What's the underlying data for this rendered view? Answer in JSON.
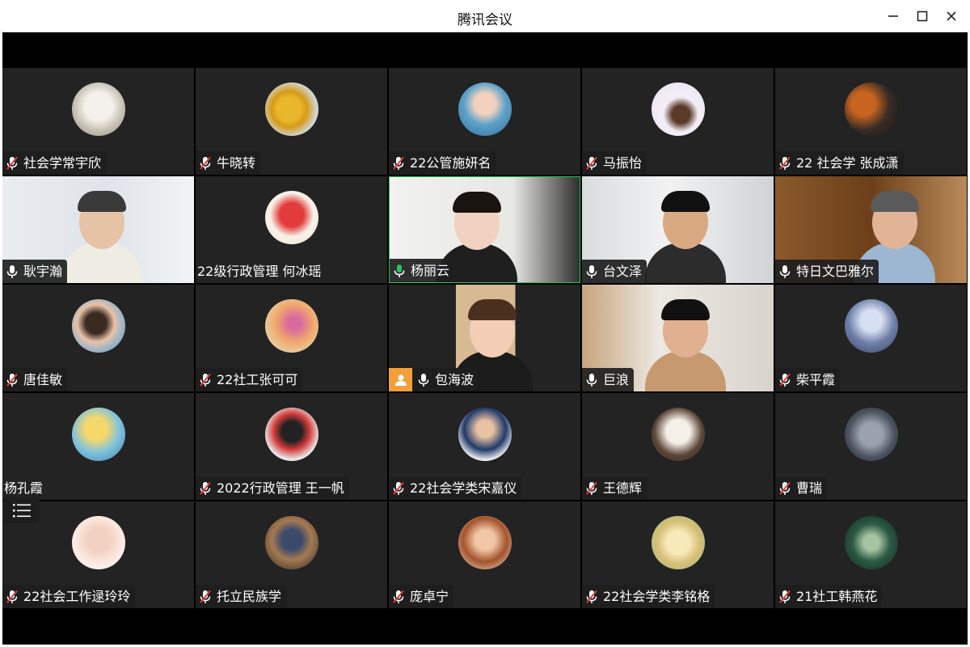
{
  "window": {
    "title": "腾讯会议",
    "controls": [
      "minimize-icon",
      "maximize-icon",
      "close-icon"
    ]
  },
  "colors": {
    "speaking": "#26c25a",
    "host_badge": "#f29f3a",
    "muted_mic": "#e03b3b"
  },
  "participants": [
    {
      "name": "社会学常宇欣",
      "mic": "muted",
      "view": "avatar"
    },
    {
      "name": "牛晓转",
      "mic": "muted",
      "view": "avatar"
    },
    {
      "name": "22公管施妍名",
      "mic": "muted",
      "view": "avatar"
    },
    {
      "name": "马振怡",
      "mic": "muted",
      "view": "avatar"
    },
    {
      "name": "22 社会学 张成潇",
      "mic": "muted",
      "view": "avatar"
    },
    {
      "name": "耿宇瀚",
      "mic": "on",
      "view": "video"
    },
    {
      "name": "22级行政管理 何冰瑶",
      "mic": "none",
      "view": "avatar"
    },
    {
      "name": "杨丽云",
      "mic": "speaking",
      "view": "video"
    },
    {
      "name": "台文泽",
      "mic": "on",
      "view": "video"
    },
    {
      "name": "特日文巴雅尔",
      "mic": "on",
      "view": "video"
    },
    {
      "name": "唐佳敏",
      "mic": "muted",
      "view": "avatar"
    },
    {
      "name": "22社工张可可",
      "mic": "muted",
      "view": "avatar"
    },
    {
      "name": "包海波",
      "mic": "on",
      "view": "video",
      "host": true
    },
    {
      "name": "巨浪",
      "mic": "on",
      "view": "video"
    },
    {
      "name": "柴平霞",
      "mic": "muted",
      "view": "avatar"
    },
    {
      "name": "杨孔霞",
      "mic": "none",
      "view": "avatar"
    },
    {
      "name": "2022行政管理 王一帆",
      "mic": "muted",
      "view": "avatar"
    },
    {
      "name": "22社会学类宋嘉仪",
      "mic": "muted",
      "view": "avatar"
    },
    {
      "name": "王德辉",
      "mic": "muted",
      "view": "avatar"
    },
    {
      "name": "曹瑞",
      "mic": "muted",
      "view": "avatar"
    },
    {
      "name": "22社会工作逯玲玲",
      "mic": "muted",
      "view": "avatar"
    },
    {
      "name": "托立民族学",
      "mic": "muted",
      "view": "avatar"
    },
    {
      "name": "庞卓宁",
      "mic": "muted",
      "view": "avatar"
    },
    {
      "name": "22社会学类李铭格",
      "mic": "muted",
      "view": "avatar"
    },
    {
      "name": "21社工韩燕花",
      "mic": "muted",
      "view": "avatar"
    }
  ],
  "toolbar": {
    "icon": "list-icon"
  }
}
